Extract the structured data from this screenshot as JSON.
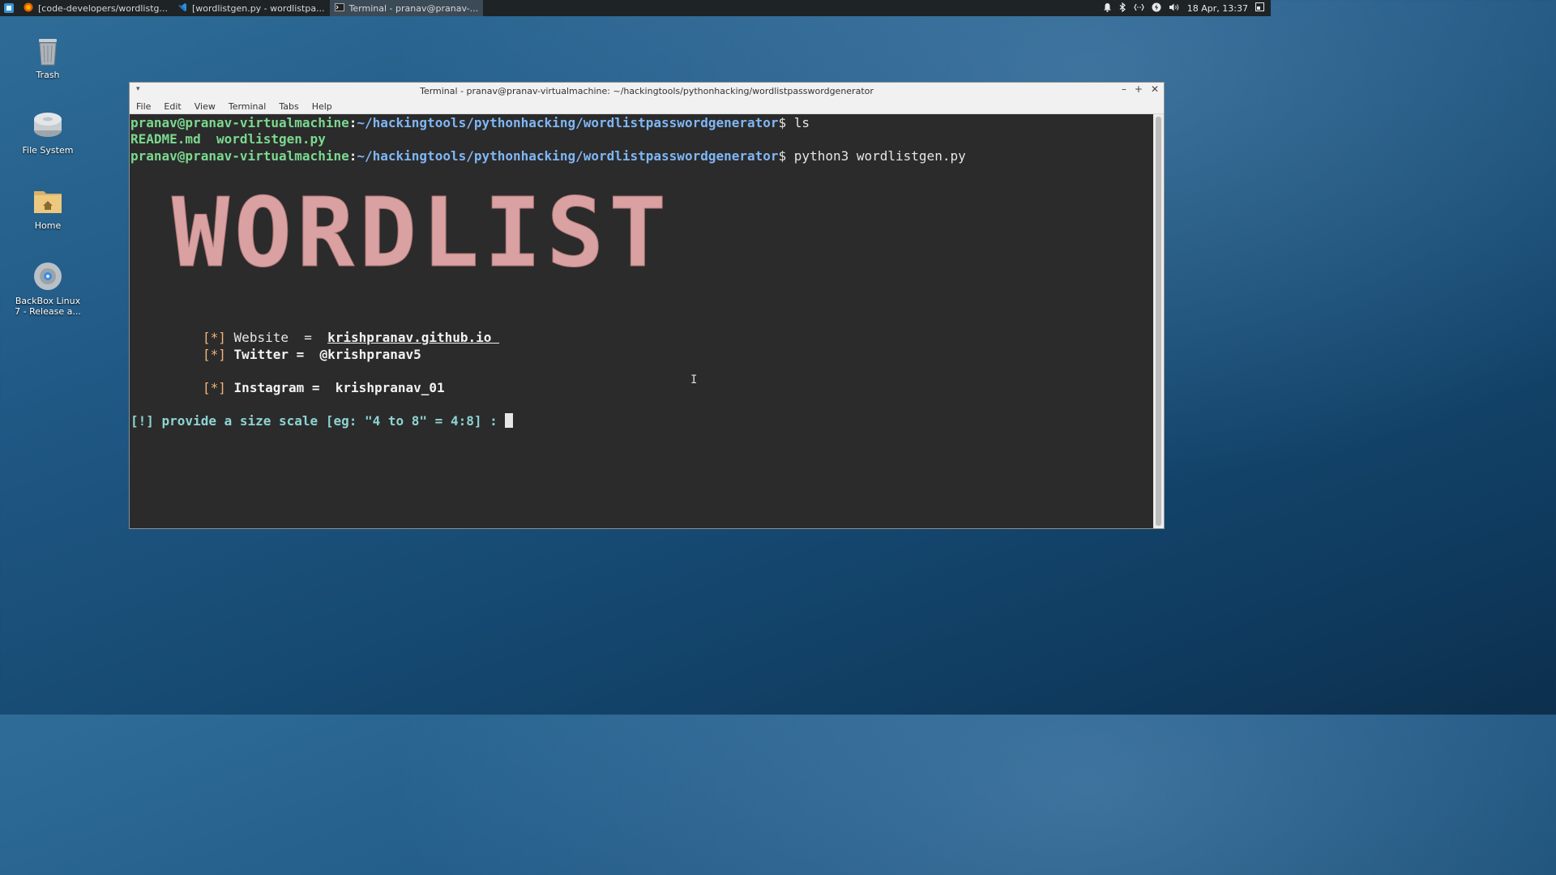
{
  "taskbar": {
    "tasks": [
      {
        "label": "[code-developers/wordlistg...",
        "icon": "firefox-icon",
        "active": false
      },
      {
        "label": "[wordlistgen.py - wordlistpa...",
        "icon": "vscode-icon",
        "active": false
      },
      {
        "label": "Terminal - pranav@pranav-...",
        "icon": "terminal-icon",
        "active": true
      }
    ],
    "clock": "18 Apr, 13:37"
  },
  "desktop": {
    "icons": [
      {
        "label": "Trash"
      },
      {
        "label": "File System"
      },
      {
        "label": "Home"
      },
      {
        "label": "BackBox Linux 7 - Release a..."
      }
    ]
  },
  "window": {
    "title": "Terminal - pranav@pranav-virtualmachine: ~/hackingtools/pythonhacking/wordlistpasswordgenerator",
    "menu": [
      "File",
      "Edit",
      "View",
      "Terminal",
      "Tabs",
      "Help"
    ]
  },
  "terminal": {
    "user_host": "pranav@pranav-virtualmachine",
    "path": "~/hackingtools/pythonhacking/wordlistpasswordgenerator",
    "cmd1": "ls",
    "ls_output": "README.md  wordlistgen.py",
    "cmd2": "python3 wordlistgen.py",
    "banner": "WORDLIST",
    "info": {
      "bullet": "[*]",
      "website_label": "Website  =  ",
      "website_value": "krishpranav.github.io ",
      "twitter_label": "Twitter =  ",
      "twitter_value": "@krishpranav5",
      "instagram_label": "Instagram =  ",
      "instagram_value": "krishpranav_01"
    },
    "prompt": "[!] provide a size scale [eg: \"4 to 8\" = 4:8] : "
  }
}
